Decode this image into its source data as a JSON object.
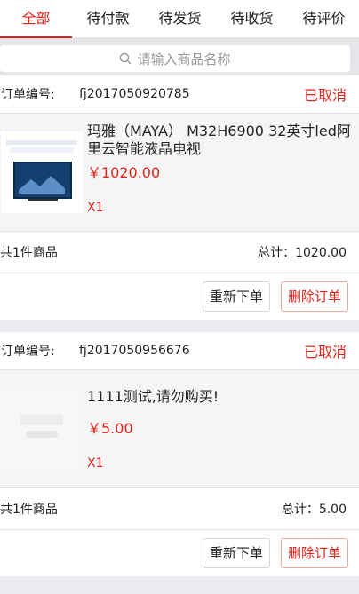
{
  "tabs": [
    "全部",
    "待付款",
    "待发货",
    "待收货",
    "待评价"
  ],
  "search": {
    "placeholder": "请输入商品名称"
  },
  "orders": [
    {
      "order_label": "订单编号:",
      "order_no": "fj2017050920785",
      "status": "已取消",
      "item": {
        "title": "玛雅（MAYA） M32H6900 32英寸led阿里云智能液晶电视",
        "price": "￥1020.00",
        "qty": "X1",
        "thumb_icon": "tv-product-icon"
      },
      "count_text": "共1件商品",
      "total_text": "总计：1020.00",
      "buttons": {
        "reorder": "重新下单",
        "delete": "删除订单"
      }
    },
    {
      "order_label": "订单编号:",
      "order_no": "fj2017050956676",
      "status": "已取消",
      "item": {
        "title": "1111测试,请勿购买!",
        "price": "￥5.00",
        "qty": "X1",
        "thumb_icon": "placeholder-logo-icon"
      },
      "count_text": "共1件商品",
      "total_text": "总计：5.00",
      "buttons": {
        "reorder": "重新下单",
        "delete": "删除订单"
      }
    }
  ]
}
